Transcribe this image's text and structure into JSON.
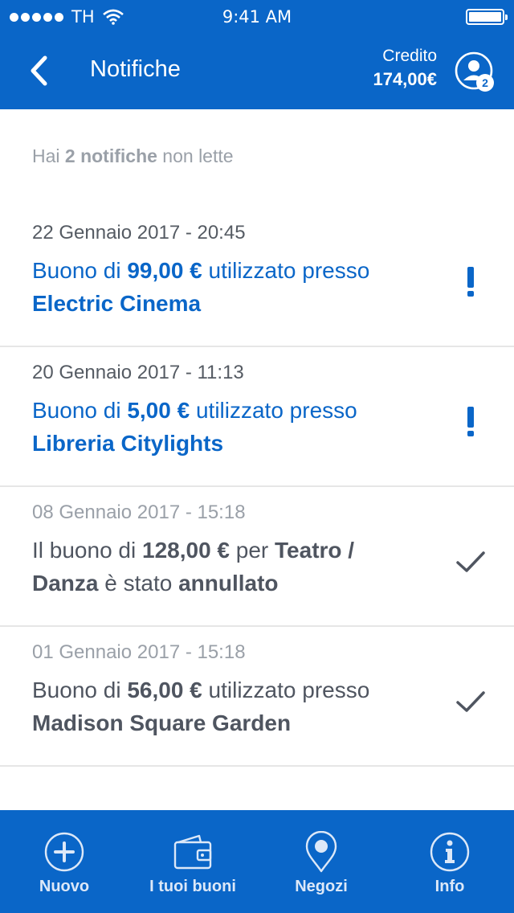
{
  "status_bar": {
    "carrier": "TH",
    "time": "9:41 AM"
  },
  "header": {
    "title": "Notifiche",
    "credit_label": "Credito",
    "credit_value": "174,00€",
    "profile_badge": "2"
  },
  "summary": {
    "prefix": "Hai ",
    "count_text": "2 notifiche",
    "suffix": " non lette"
  },
  "notifications": [
    {
      "date": "22 Gennaio 2017 - 20:45",
      "p1": "Buono di ",
      "amount": "99,00 €",
      "p2": " utilizzato presso ",
      "place": "Electric Cinema",
      "status": "unread",
      "icon": "exclamation-icon"
    },
    {
      "date": "20 Gennaio 2017 - 11:13",
      "p1": "Buono di ",
      "amount": "5,00 €",
      "p2": " utilizzato presso ",
      "place": "Libreria Citylights",
      "status": "unread",
      "icon": "exclamation-icon"
    },
    {
      "date": "08 Gennaio 2017 - 15:18",
      "p1": "Il buono di ",
      "amount": "128,00 €",
      "p2": " per ",
      "place": "Teatro / Danza",
      "p3": " è stato ",
      "state": "annullato",
      "status": "read",
      "icon": "checkmark-icon"
    },
    {
      "date": "01 Gennaio 2017 - 15:18",
      "p1": "Buono di ",
      "amount": "56,00 €",
      "p2": " utilizzato presso ",
      "place": "Madison Square Garden",
      "status": "read",
      "icon": "checkmark-icon"
    }
  ],
  "tab_bar": {
    "items": [
      {
        "label": "Nuovo",
        "icon": "plus-circle-icon"
      },
      {
        "label": "I tuoi buoni",
        "icon": "wallet-icon"
      },
      {
        "label": "Negozi",
        "icon": "map-pin-icon"
      },
      {
        "label": "Info",
        "icon": "info-circle-icon"
      }
    ]
  },
  "colors": {
    "brand_blue": "#0a66c8",
    "muted_gray": "#9aa0a8",
    "read_text": "#4f5560"
  }
}
